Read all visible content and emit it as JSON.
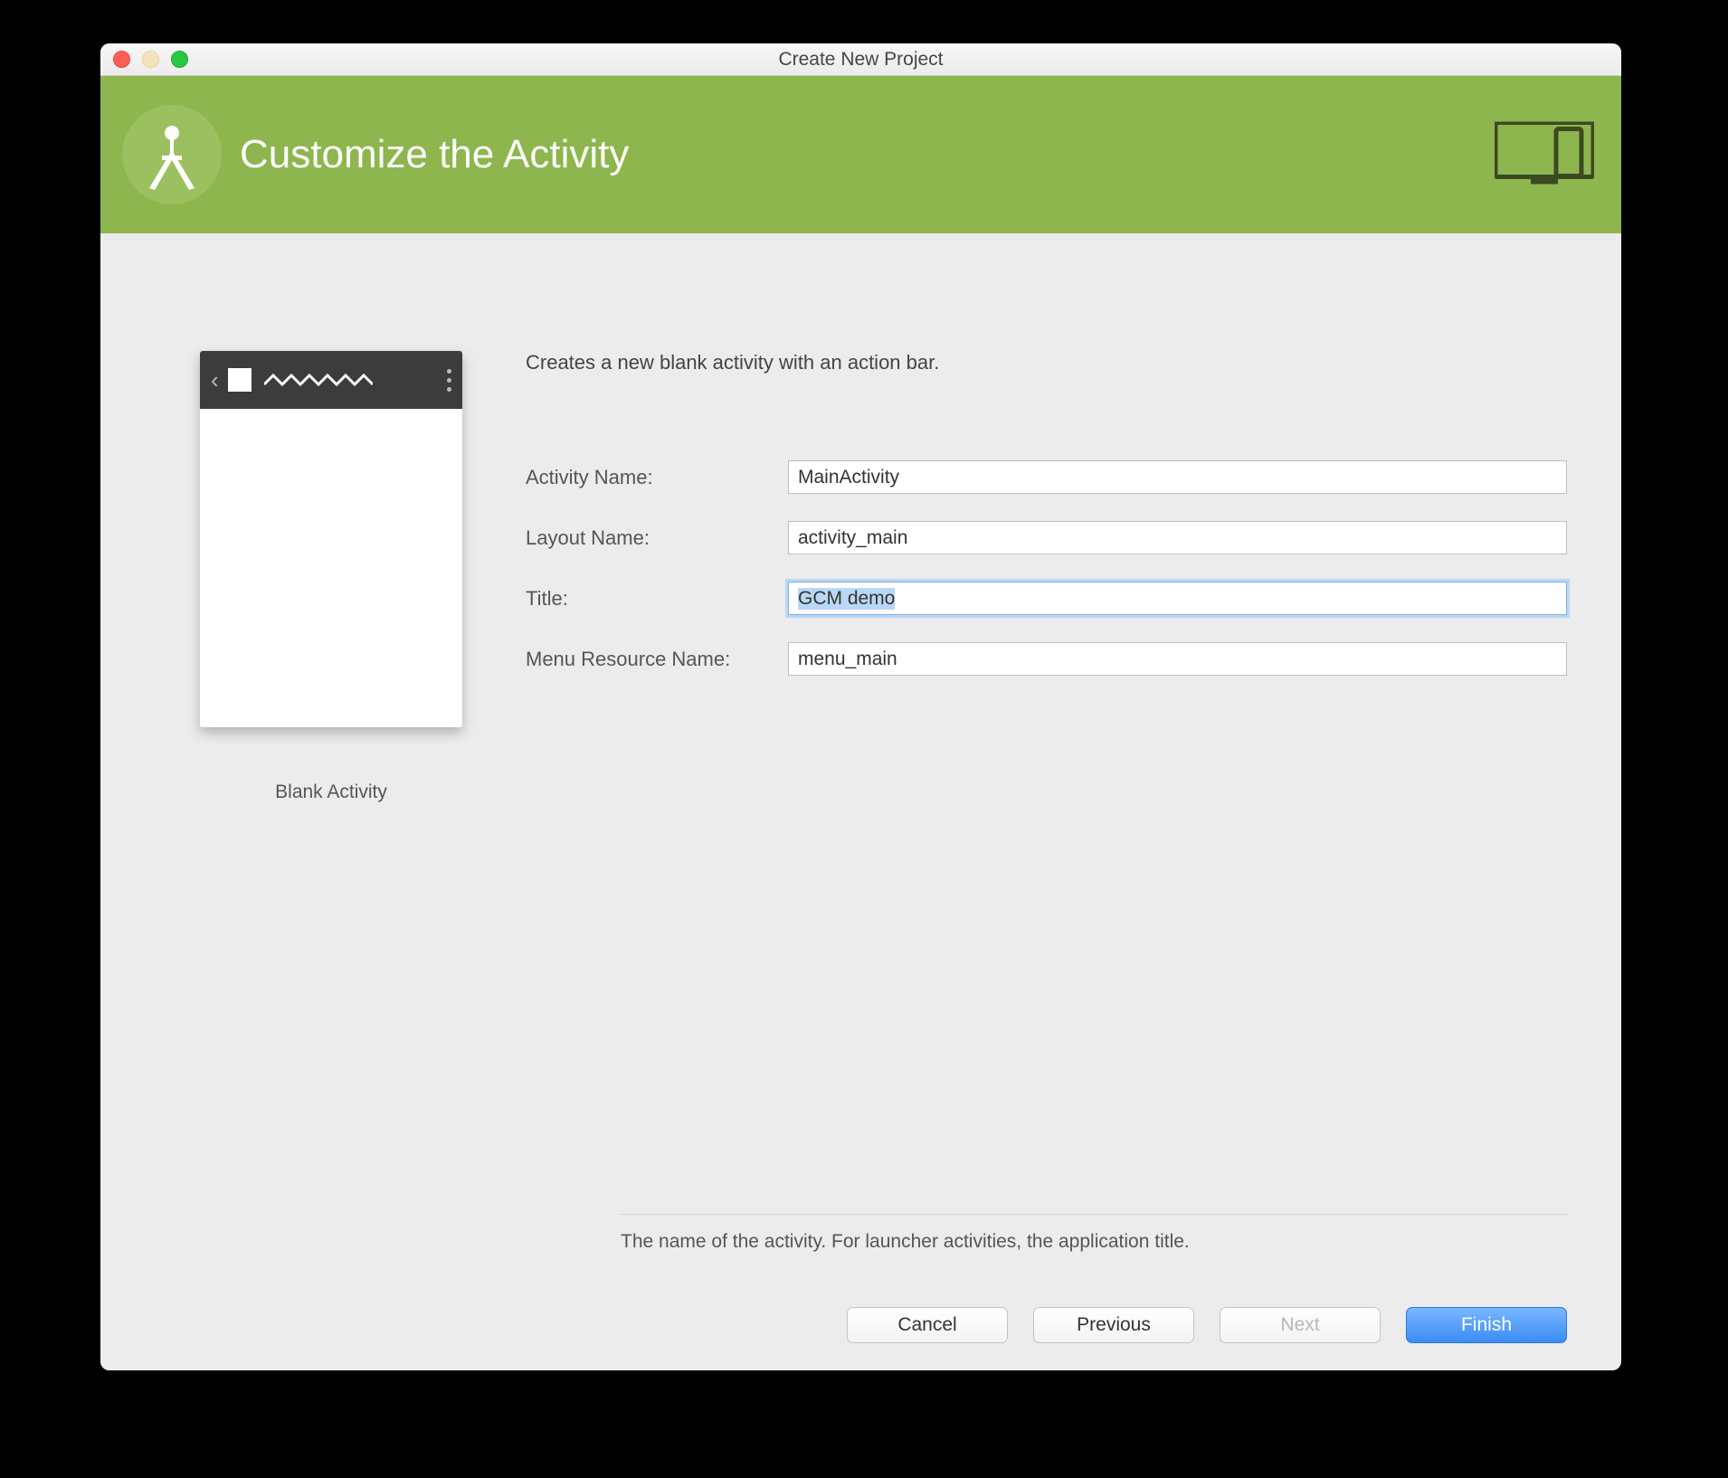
{
  "window_title": "Create New Project",
  "header": {
    "title": "Customize the Activity"
  },
  "preview": {
    "caption": "Blank Activity"
  },
  "form": {
    "description": "Creates a new blank activity with an action bar.",
    "fields": {
      "activity_name": {
        "label": "Activity Name:",
        "value": "MainActivity"
      },
      "layout_name": {
        "label": "Layout Name:",
        "value": "activity_main"
      },
      "title": {
        "label": "Title:",
        "value": "GCM demo"
      },
      "menu_name": {
        "label": "Menu Resource Name:",
        "value": "menu_main"
      }
    },
    "hint": "The name of the activity. For launcher activities, the application title."
  },
  "buttons": {
    "cancel": "Cancel",
    "previous": "Previous",
    "next": "Next",
    "finish": "Finish"
  }
}
